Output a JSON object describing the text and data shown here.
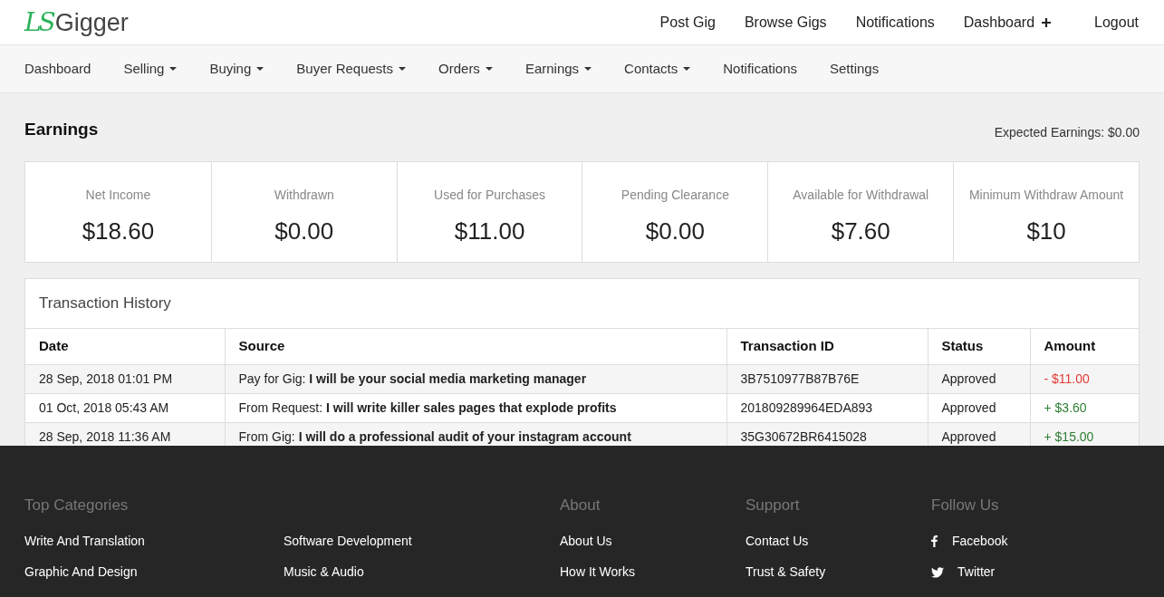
{
  "logo": {
    "mark": "LS",
    "name": "Gigger"
  },
  "top_nav": [
    {
      "label": "Post Gig",
      "plus": false
    },
    {
      "label": "Browse Gigs",
      "plus": false
    },
    {
      "label": "Notifications",
      "plus": false
    },
    {
      "label": "Dashboard",
      "plus": true
    },
    {
      "label": "Logout",
      "plus": false
    }
  ],
  "sub_nav": [
    {
      "label": "Dashboard",
      "dropdown": false
    },
    {
      "label": "Selling",
      "dropdown": true
    },
    {
      "label": "Buying",
      "dropdown": true
    },
    {
      "label": "Buyer Requests",
      "dropdown": true
    },
    {
      "label": "Orders",
      "dropdown": true
    },
    {
      "label": "Earnings",
      "dropdown": true
    },
    {
      "label": "Contacts",
      "dropdown": true
    },
    {
      "label": "Notifications",
      "dropdown": false
    },
    {
      "label": "Settings",
      "dropdown": false
    }
  ],
  "page_title": "Earnings",
  "expected_earnings": "Expected Earnings: $0.00",
  "stats": [
    {
      "label": "Net Income",
      "value": "$18.60"
    },
    {
      "label": "Withdrawn",
      "value": "$0.00"
    },
    {
      "label": "Used for Purchases",
      "value": "$11.00"
    },
    {
      "label": "Pending Clearance",
      "value": "$0.00"
    },
    {
      "label": "Available for Withdrawal",
      "value": "$7.60"
    },
    {
      "label": "Minimum Withdraw Amount",
      "value": "$10"
    }
  ],
  "transactions": {
    "title": "Transaction History",
    "columns": [
      "Date",
      "Source",
      "Transaction ID",
      "Status",
      "Amount"
    ],
    "rows": [
      {
        "date": "28 Sep, 2018 01:01 PM",
        "source": "Pay for Gig: **I will be your social media marketing manager**",
        "id": "3B7510977B87B76E",
        "status": "Approved",
        "amount": "- $11.00",
        "kind": "debit"
      },
      {
        "date": "01 Oct, 2018 05:43 AM",
        "source": "From Request: **I will write killer sales pages that explode profits**",
        "id": "201809289964EDA893",
        "status": "Approved",
        "amount": "+ $3.60",
        "kind": "credit"
      },
      {
        "date": "28 Sep, 2018 11:36 AM",
        "source": "From Gig: **I will do a professional audit of your instagram account**",
        "id": "35G30672BR6415028",
        "status": "Approved",
        "amount": "+ $15.00",
        "kind": "credit"
      }
    ]
  },
  "footer": {
    "categories": {
      "title": "Top Categories",
      "items": [
        "Write And Translation",
        "Software Development",
        "Graphic And Design",
        "Music & Audio"
      ]
    },
    "about": {
      "title": "About",
      "items": [
        "About Us",
        "How It Works"
      ]
    },
    "support": {
      "title": "Support",
      "items": [
        "Contact Us",
        "Trust & Safety"
      ]
    },
    "follow": {
      "title": "Follow Us",
      "items": [
        {
          "label": "Facebook",
          "kind": "facebook"
        },
        {
          "label": "Twitter",
          "kind": "twitter"
        }
      ]
    }
  }
}
